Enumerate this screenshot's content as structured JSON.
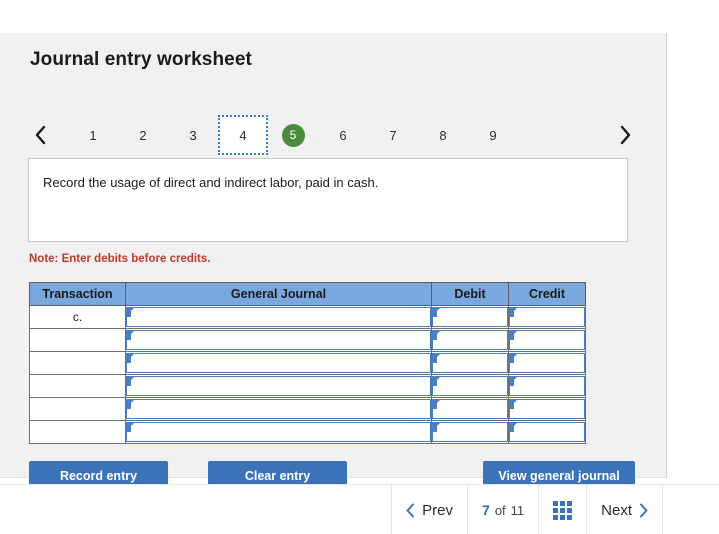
{
  "worksheet": {
    "title": "Journal entry worksheet",
    "tabs": [
      {
        "label": "1",
        "state": "normal"
      },
      {
        "label": "2",
        "state": "normal"
      },
      {
        "label": "3",
        "state": "normal"
      },
      {
        "label": "4",
        "state": "focused"
      },
      {
        "label": "5",
        "state": "active"
      },
      {
        "label": "6",
        "state": "normal"
      },
      {
        "label": "7",
        "state": "normal"
      },
      {
        "label": "8",
        "state": "normal"
      },
      {
        "label": "9",
        "state": "normal"
      }
    ],
    "prev_arrow_icon": "chevron-left-icon",
    "next_arrow_icon": "chevron-right-icon",
    "description": "Record the usage of direct and indirect labor, paid in cash.",
    "note": "Note: Enter debits before credits.",
    "table": {
      "headers": [
        "Transaction",
        "General Journal",
        "Debit",
        "Credit"
      ],
      "rows": [
        {
          "transaction": "c.",
          "general_journal": "",
          "debit": "",
          "credit": ""
        },
        {
          "transaction": "",
          "general_journal": "",
          "debit": "",
          "credit": ""
        },
        {
          "transaction": "",
          "general_journal": "",
          "debit": "",
          "credit": ""
        },
        {
          "transaction": "",
          "general_journal": "",
          "debit": "",
          "credit": ""
        },
        {
          "transaction": "",
          "general_journal": "",
          "debit": "",
          "credit": ""
        },
        {
          "transaction": "",
          "general_journal": "",
          "debit": "",
          "credit": ""
        }
      ]
    },
    "buttons": {
      "record_entry": "Record entry",
      "clear_entry": "Clear entry",
      "view_general_journal": "View general journal"
    }
  },
  "pager": {
    "prev_label": "Prev",
    "next_label": "Next",
    "current_page": "7",
    "of_label": "of",
    "total_pages": "11",
    "grid_icon": "grid-view-icon",
    "prev_icon": "chevron-left-icon",
    "next_icon": "chevron-right-icon"
  },
  "colors": {
    "panel_bg": "#f1f1f1",
    "button_blue": "#3b73b9",
    "table_header_blue": "#78a8dd",
    "active_tab_green": "#4b8b3f",
    "note_red": "#c0392b",
    "cell_border_blue": "#4a7fc1"
  }
}
